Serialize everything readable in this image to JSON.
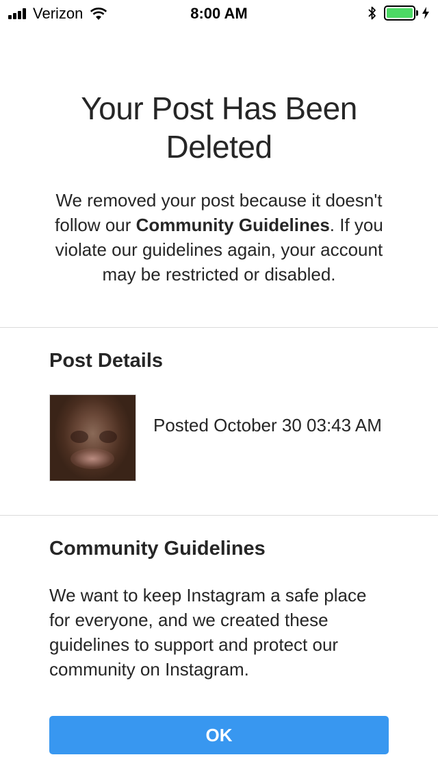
{
  "status_bar": {
    "carrier": "Verizon",
    "time": "8:00 AM",
    "battery_level": 1.0,
    "battery_color": "#4cd964",
    "icons": [
      "signal-icon",
      "wifi-icon",
      "bluetooth-icon",
      "battery-icon",
      "charging-icon"
    ]
  },
  "header": {
    "title": "Your Post Has Been Deleted",
    "intro_part1": "We removed your post because it doesn't follow our ",
    "intro_bold": "Community Guidelines",
    "intro_part2": ". If you violate our guidelines again, your account may be restricted or disabled."
  },
  "post_details": {
    "heading": "Post Details",
    "posted_text": "Posted October 30 03:43 AM"
  },
  "guidelines": {
    "heading": "Community Guidelines",
    "body": "We want to keep Instagram a safe place for everyone, and we created these guidelines to support and protect our community on Instagram."
  },
  "actions": {
    "ok_label": "OK",
    "ok_color": "#3897f0"
  }
}
